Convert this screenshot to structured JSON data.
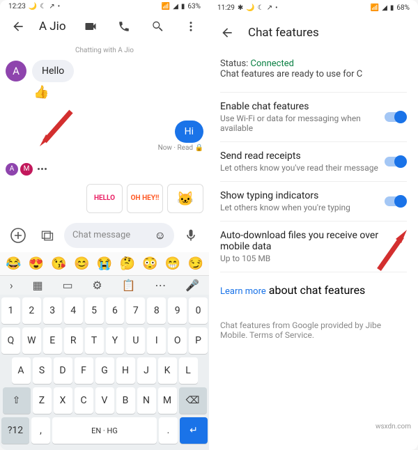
{
  "left": {
    "status": {
      "time": "12:23",
      "battery": "63%"
    },
    "header": {
      "title": "A Jio"
    },
    "chatting_with": "Chatting with A Jio",
    "msg_in": "Hello",
    "thumb": "👍",
    "msg_out": "Hi",
    "msg_meta": "Now · Read 🔒",
    "avatars": [
      "A",
      "M"
    ],
    "stickers": [
      "HELLO",
      "OH HEY!!",
      "🐱"
    ],
    "compose": {
      "placeholder": "Chat message"
    },
    "emoji_strip": [
      "😂",
      "😍",
      "😘",
      "😊",
      "😭",
      "🤔",
      "😳",
      "😁",
      "😏"
    ],
    "kb_nums": [
      "1",
      "2",
      "3",
      "4",
      "5",
      "6",
      "7",
      "8",
      "9",
      "0"
    ],
    "kb_r1": [
      "Q",
      "W",
      "E",
      "R",
      "T",
      "Y",
      "U",
      "I",
      "O",
      "P"
    ],
    "kb_r2": [
      "A",
      "S",
      "D",
      "F",
      "G",
      "H",
      "J",
      "K",
      "L"
    ],
    "kb_r3": [
      "Z",
      "X",
      "C",
      "V",
      "B",
      "N",
      "M"
    ],
    "kb_shift": "⇧",
    "kb_bksp": "⌫",
    "kb_sym": "?12",
    "kb_comma": ",",
    "kb_space": "EN · HG",
    "kb_period": ".",
    "kb_enter": "↵"
  },
  "right": {
    "status": {
      "time": "11:29",
      "battery": "68%"
    },
    "header": {
      "title": "Chat features"
    },
    "status_label": "Status: ",
    "status_value": "Connected",
    "status_desc": "Chat features are ready to use for C",
    "items": [
      {
        "title": "Enable chat features",
        "desc": "Use Wi-Fi or data for messaging when available"
      },
      {
        "title": "Send read receipts",
        "desc": "Let others know you've read their message"
      },
      {
        "title": "Show typing indicators",
        "desc": "Let others know when you're typing"
      },
      {
        "title": "Auto-download files you receive over mobile data",
        "desc": "Up to 105 MB"
      }
    ],
    "learn_more": "Learn more",
    "learn_more_rest": " about chat features",
    "footer": "Chat features from Google provided by Jibe Mobile. Terms of Service."
  },
  "watermark": "wsxdn.com"
}
